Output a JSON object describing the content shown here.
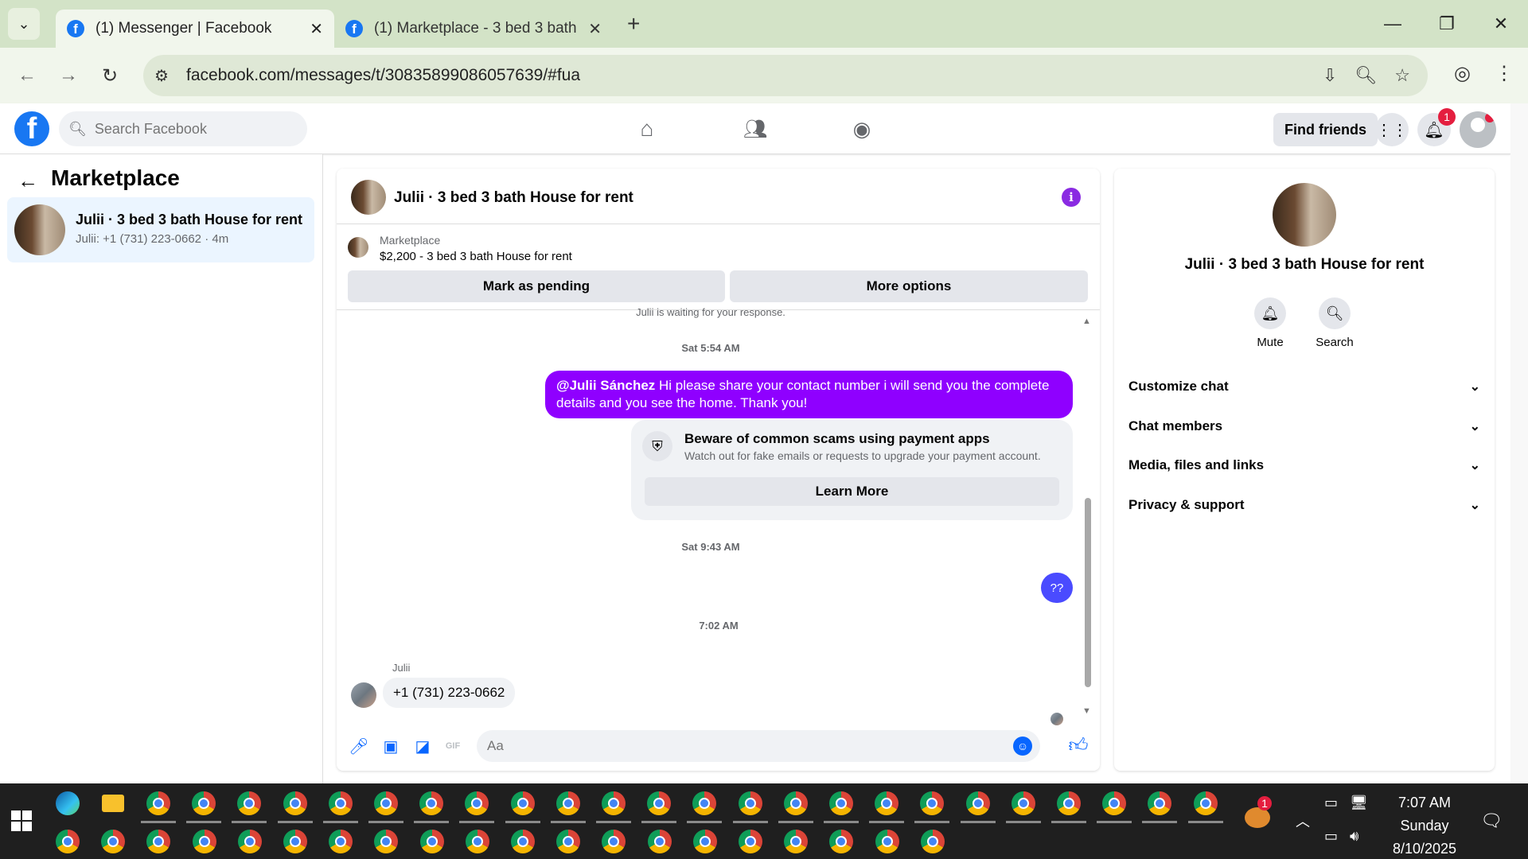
{
  "browser": {
    "tabs": [
      {
        "title": "(1) Messenger | Facebook",
        "favicon": "facebook-icon",
        "active": true
      },
      {
        "title": "(1) Marketplace - 3 bed 3 bath ",
        "favicon": "facebook-icon",
        "active": false
      }
    ],
    "url": "facebook.com/messages/t/30835899086057639/#fua"
  },
  "fb_header": {
    "search_placeholder": "Search Facebook",
    "find_friends_label": "Find friends",
    "notification_count": "1"
  },
  "left_panel": {
    "title": "Marketplace",
    "conversation": {
      "name": "Julii · 3 bed 3 bath House for rent",
      "preview": "Julii: +1 (731) 223-0662 · 4m"
    }
  },
  "chat": {
    "title": "Julii · 3 bed 3 bath House for rent",
    "listing": {
      "label": "Marketplace",
      "price_title": "$2,200 - 3 bed 3 bath House for rent",
      "mark_pending": "Mark as pending",
      "more_options": "More options"
    },
    "waiting_text": "Julii is waiting for your response.",
    "messages": [
      {
        "type": "timestamp",
        "text": "Sat 5:54 AM"
      },
      {
        "type": "outgoing",
        "mention": "@Julii Sánchez",
        "text": " Hi please share your contact number i will send you the complete details and you see the home. Thank you!"
      },
      {
        "type": "scam_warning",
        "title": "Beware of common scams using payment apps",
        "subtitle": "Watch out for fake emails or requests to upgrade your payment account.",
        "button": "Learn More"
      },
      {
        "type": "timestamp",
        "text": "Sat 9:43 AM"
      },
      {
        "type": "outgoing",
        "text": "??"
      },
      {
        "type": "timestamp",
        "text": "7:02 AM"
      },
      {
        "type": "incoming",
        "sender": "Julii",
        "text": "+1 (731) 223-0662"
      }
    ],
    "composer_placeholder": "Aa"
  },
  "right_panel": {
    "title": "Julii · 3 bed 3 bath House for rent",
    "actions": [
      {
        "label": "Mute",
        "icon": "bell-icon"
      },
      {
        "label": "Search",
        "icon": "search-icon"
      }
    ],
    "sections": [
      {
        "label": "Customize chat"
      },
      {
        "label": "Chat members"
      },
      {
        "label": "Media, files and links"
      },
      {
        "label": "Privacy & support"
      }
    ]
  },
  "taskbar": {
    "time": "7:07 AM",
    "day": "Sunday",
    "date": "8/10/2025",
    "weather_badge": "1"
  },
  "colors": {
    "fb_blue": "#1877f2",
    "messenger_purple": "#8f00ff",
    "browser_frame": "#d3e3c7",
    "selected_conversation": "#ebf5ff"
  }
}
